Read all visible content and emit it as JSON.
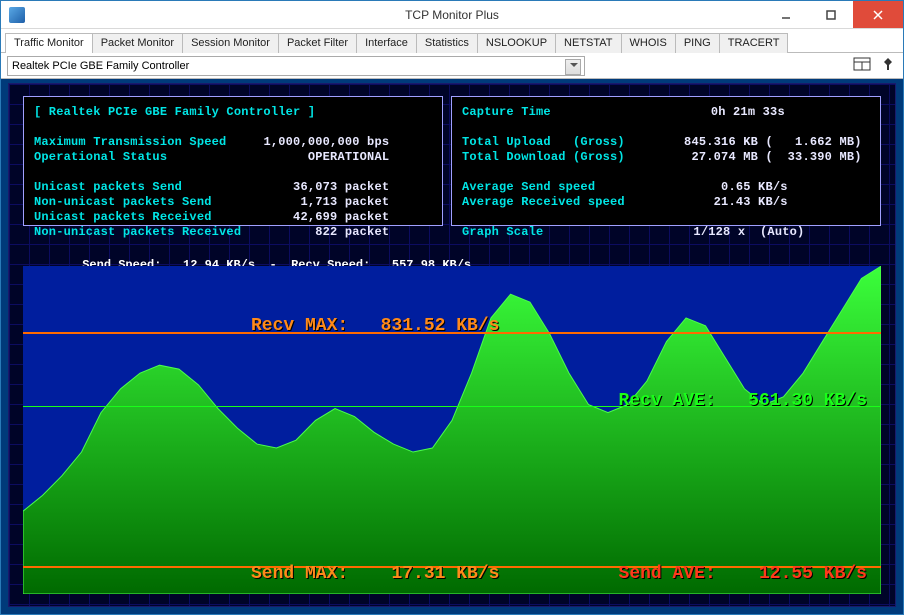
{
  "window": {
    "title": "TCP Monitor Plus"
  },
  "tabs": [
    "Traffic Monitor",
    "Packet Monitor",
    "Session Monitor",
    "Packet Filter",
    "Interface",
    "Statistics",
    "NSLOOKUP",
    "NETSTAT",
    "WHOIS",
    "PING",
    "TRACERT"
  ],
  "active_tab_index": 0,
  "adapter": "Realtek PCIe GBE Family Controller",
  "panel_left": {
    "title": "[ Realtek PCIe GBE Family Controller ]",
    "rows": [
      {
        "label": "Maximum Transmission Speed",
        "value": "1,000,000,000 bps"
      },
      {
        "label": "Operational Status",
        "value": "OPERATIONAL"
      }
    ],
    "packet_rows": [
      {
        "label": "Unicast packets Send",
        "value": "36,073 packet"
      },
      {
        "label": "Non-unicast packets Send",
        "value": "1,713 packet"
      },
      {
        "label": "Unicast packets Received",
        "value": "42,699 packet"
      },
      {
        "label": "Non-unicast packets Received",
        "value": "822 packet"
      }
    ]
  },
  "panel_right": {
    "capture_time_label": "Capture Time",
    "capture_time_value": "0h 21m 33s",
    "totals": [
      {
        "label": "Total Upload   (Gross)",
        "kb": "845.316 KB",
        "mb": "1.662 MB"
      },
      {
        "label": "Total Download (Gross)",
        "kb": "27.074 MB",
        "mb": "33.390 MB"
      }
    ],
    "averages": [
      {
        "label": "Average Send speed",
        "value": "0.65 KB/s"
      },
      {
        "label": "Average Received speed",
        "value": "21.43 KB/s"
      }
    ],
    "graph_scale_label": "Graph Scale",
    "graph_scale_value": "1/128 x  (Auto)"
  },
  "speed_bar": {
    "send_label": "Send Speed:",
    "send_value": "12.94 KB/s",
    "sep": "-",
    "recv_label": "Recv Speed:",
    "recv_value": "557.98 KB/s"
  },
  "overlays": {
    "recv_max": {
      "label": "Recv MAX:",
      "value": "831.52 KB/s"
    },
    "recv_ave": {
      "label": "Recv AVE:",
      "value": "561.30 KB/s"
    },
    "send_max": {
      "label": "Send MAX:",
      "value": "17.31 KB/s"
    },
    "send_ave": {
      "label": "Send AVE:",
      "value": "12.55 KB/s"
    }
  },
  "chart_data": {
    "type": "area",
    "title": "Traffic Monitor",
    "ylabel": "KB/s",
    "ylim": [
      0,
      831.52
    ],
    "recv_series": {
      "name": "Recv Speed",
      "color": "#19ff19",
      "values": [
        210,
        250,
        300,
        360,
        460,
        520,
        560,
        580,
        570,
        530,
        470,
        420,
        380,
        370,
        390,
        440,
        470,
        450,
        410,
        380,
        360,
        370,
        440,
        560,
        700,
        760,
        740,
        660,
        560,
        480,
        460,
        480,
        540,
        640,
        700,
        680,
        600,
        520,
        480,
        500,
        560,
        640,
        720,
        800,
        831
      ]
    },
    "send_series": {
      "name": "Send Speed",
      "color": "#ff3a1a",
      "values": [
        12.9,
        12.9,
        12.9,
        12.9,
        12.9,
        12.9,
        12.9,
        12.9,
        12.9,
        12.9,
        12.9,
        12.9,
        12.9,
        12.9,
        12.9,
        12.9,
        12.9,
        12.9,
        12.9,
        12.9,
        12.9,
        12.9,
        12.9,
        12.9,
        12.9,
        12.9,
        12.9,
        12.9,
        12.9,
        12.9,
        12.9,
        12.9,
        12.9,
        12.9,
        12.9,
        12.9,
        12.9,
        12.9,
        12.9,
        12.9,
        12.9,
        12.9,
        12.9,
        12.9,
        12.9
      ]
    },
    "lines": {
      "recv_max": 831.52,
      "recv_ave": 561.3,
      "send_max": 17.31,
      "send_ave": 12.55
    }
  }
}
